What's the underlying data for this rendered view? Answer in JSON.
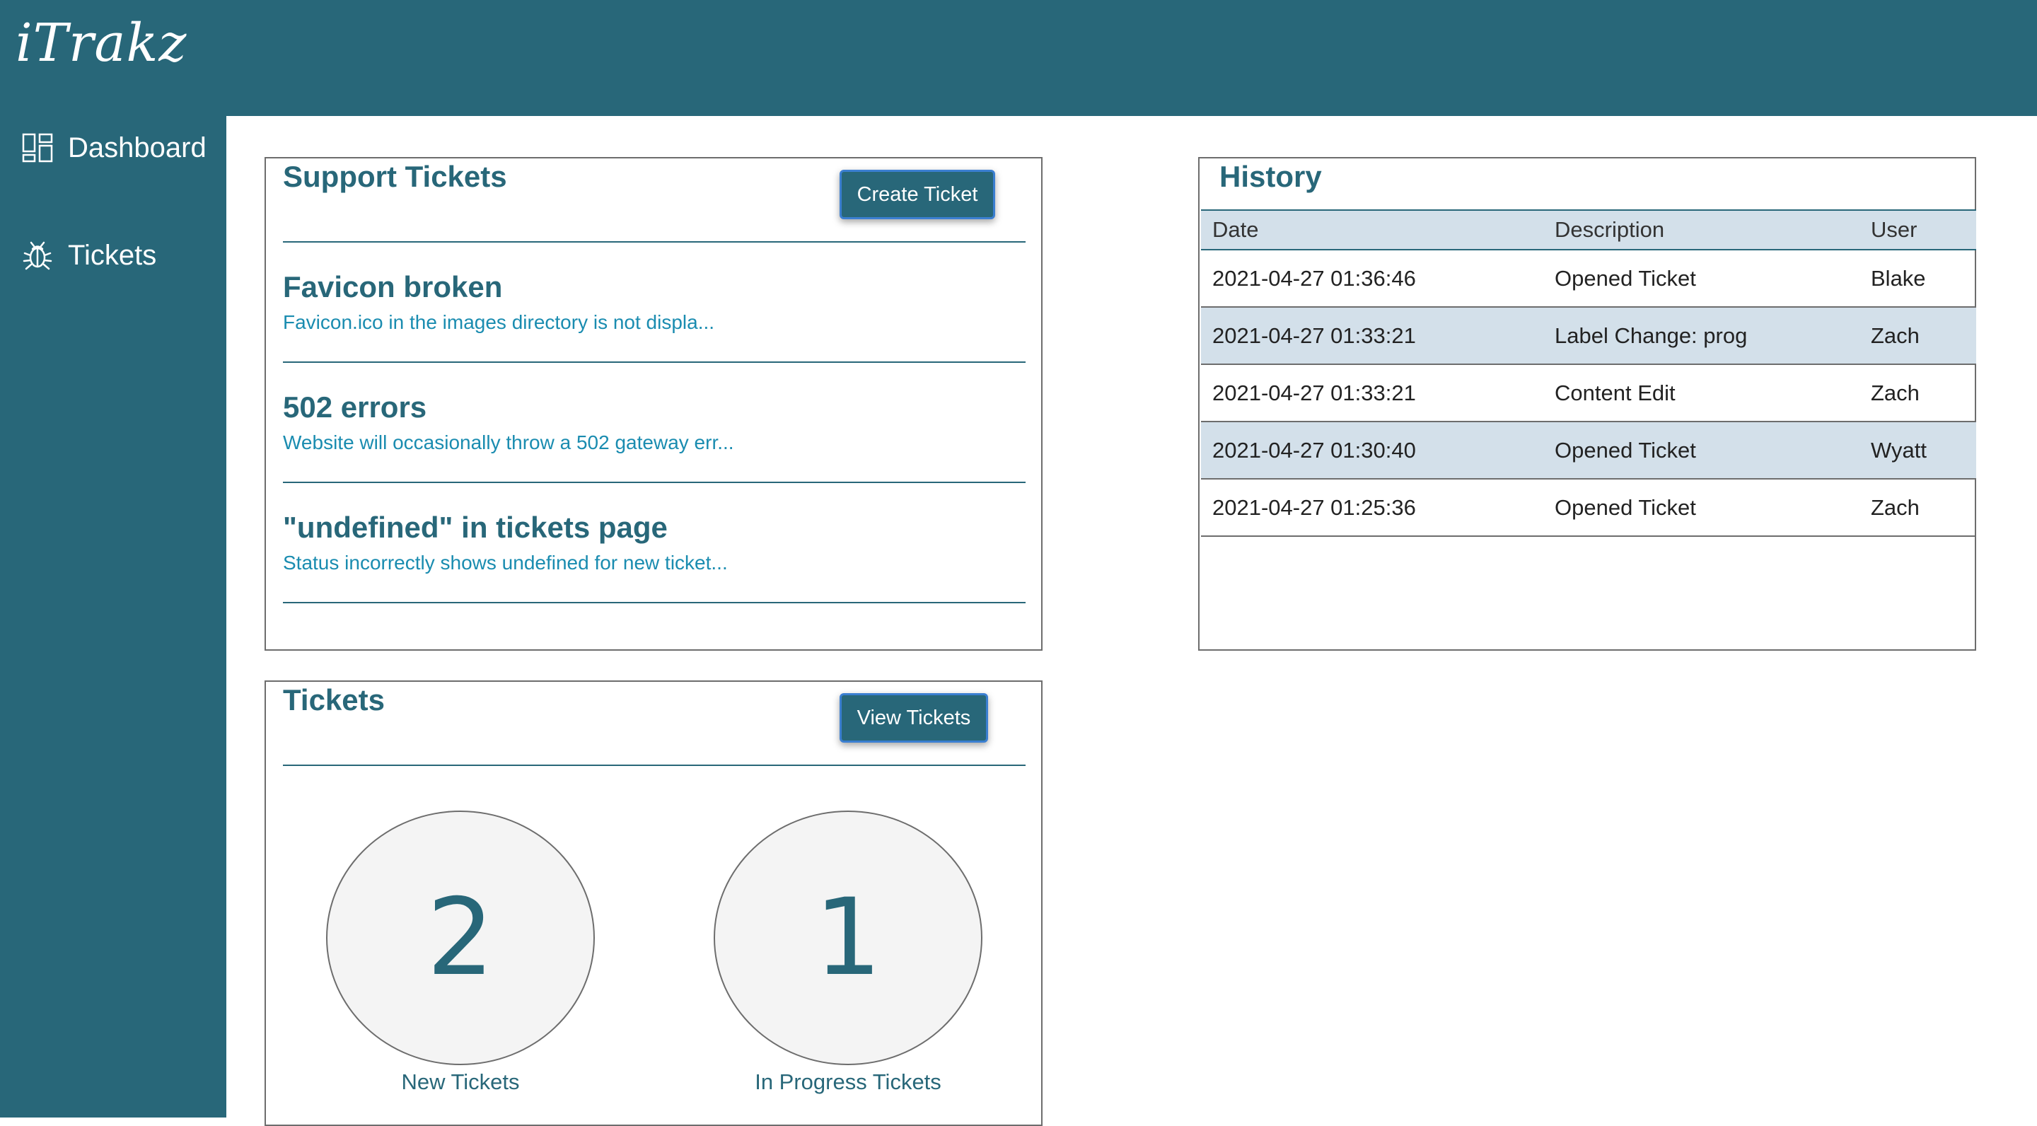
{
  "app": {
    "logo": "iTrakz"
  },
  "sidebar": {
    "items": [
      {
        "label": "Dashboard",
        "icon": "dashboard-icon"
      },
      {
        "label": "Tickets",
        "icon": "bug-icon"
      }
    ]
  },
  "support_tickets": {
    "title": "Support Tickets",
    "button_label": "Create Ticket",
    "items": [
      {
        "title": "Favicon broken",
        "description": "Favicon.ico in the images directory is not displa..."
      },
      {
        "title": "502 errors",
        "description": "Website will occasionally throw a 502 gateway err..."
      },
      {
        "title": "\"undefined\" in tickets page",
        "description": "Status incorrectly shows undefined for new ticket..."
      }
    ]
  },
  "tickets_summary": {
    "title": "Tickets",
    "button_label": "View Tickets",
    "stats": [
      {
        "value": "2",
        "label": "New Tickets"
      },
      {
        "value": "1",
        "label": "In Progress Tickets"
      }
    ]
  },
  "history": {
    "title": "History",
    "columns": [
      "Date",
      "Description",
      "User"
    ],
    "rows": [
      [
        "2021-04-27 01:36:46",
        "Opened Ticket",
        "Blake"
      ],
      [
        "2021-04-27 01:33:21",
        "Label Change: prog",
        "Zach"
      ],
      [
        "2021-04-27 01:33:21",
        "Content Edit",
        "Zach"
      ],
      [
        "2021-04-27 01:30:40",
        "Opened Ticket",
        "Wyatt"
      ],
      [
        "2021-04-27 01:25:36",
        "Opened Ticket",
        "Zach"
      ]
    ]
  },
  "colors": {
    "primary": "#286779",
    "link": "#1a8cb0",
    "row_alt": "#d3e0ea"
  }
}
